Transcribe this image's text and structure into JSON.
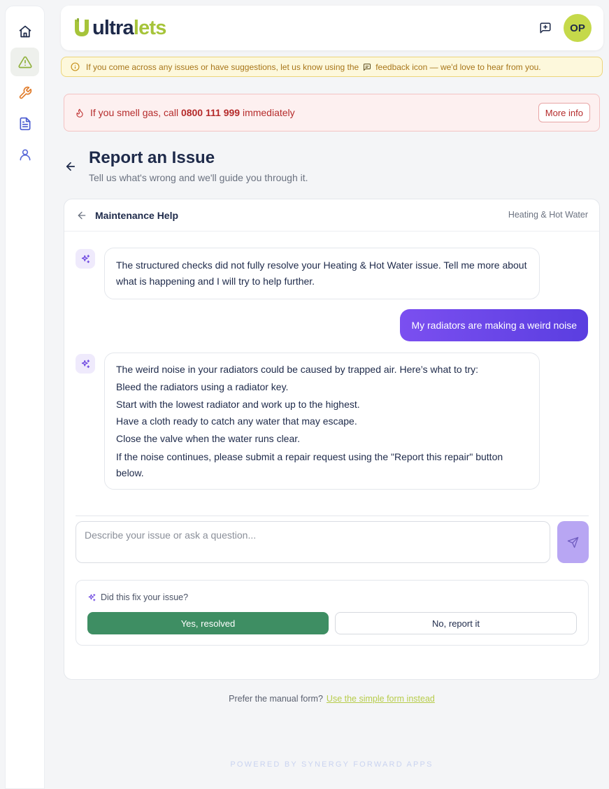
{
  "brand": {
    "name_part1": "ultra",
    "name_part2": "lets",
    "primary_color": "#a6c43a",
    "text_color": "#1e2a4a"
  },
  "sidebar": {
    "items": [
      {
        "name": "home",
        "icon": "home-icon",
        "active": false
      },
      {
        "name": "report-issue",
        "icon": "warning-triangle-icon",
        "active": true
      },
      {
        "name": "maintenance",
        "icon": "wrench-icon",
        "active": false
      },
      {
        "name": "documents",
        "icon": "document-icon",
        "active": false
      },
      {
        "name": "profile",
        "icon": "user-icon",
        "active": false
      }
    ]
  },
  "header": {
    "avatar_initials": "OP",
    "feedback_icon": "feedback-icon"
  },
  "info_banner": {
    "text_before": "If you come across any issues or have suggestions, let us know using the",
    "text_after": "feedback icon — we'd love to hear from you."
  },
  "gas_banner": {
    "text_before": "If you smell gas, call",
    "phone": "0800 111 999",
    "text_after": "immediately",
    "button_label": "More info"
  },
  "page": {
    "title": "Report an Issue",
    "subtitle": "Tell us what's wrong and we'll guide you through it."
  },
  "chat": {
    "title": "Maintenance Help",
    "category": "Heating & Hot Water",
    "messages": [
      {
        "role": "assistant",
        "text": "The structured checks did not fully resolve your Heating & Hot Water issue. Tell me more about what is happening and I will try to help further."
      },
      {
        "role": "user",
        "text": "My radiators are making a weird noise"
      },
      {
        "role": "assistant",
        "lines": [
          "The weird noise in your radiators could be caused by trapped air. Here’s what to try:",
          "Bleed the radiators using a radiator key.",
          "Start with the lowest radiator and work up to the highest.",
          "Have a cloth ready to catch any water that may escape.",
          "Close the valve when the water runs clear.",
          "If the noise continues, please submit a repair request using the \"Report this repair\" button below."
        ]
      }
    ],
    "input_placeholder": "Describe your issue or ask a question...",
    "input_value": "",
    "fix_question": "Did this fix your issue?",
    "yes_label": "Yes, resolved",
    "no_label": "No, report it"
  },
  "footer": {
    "manual_prompt": "Prefer the manual form?",
    "manual_link": "Use the simple form instead",
    "powered_by": "POWERED BY SYNERGY FORWARD APPS"
  }
}
